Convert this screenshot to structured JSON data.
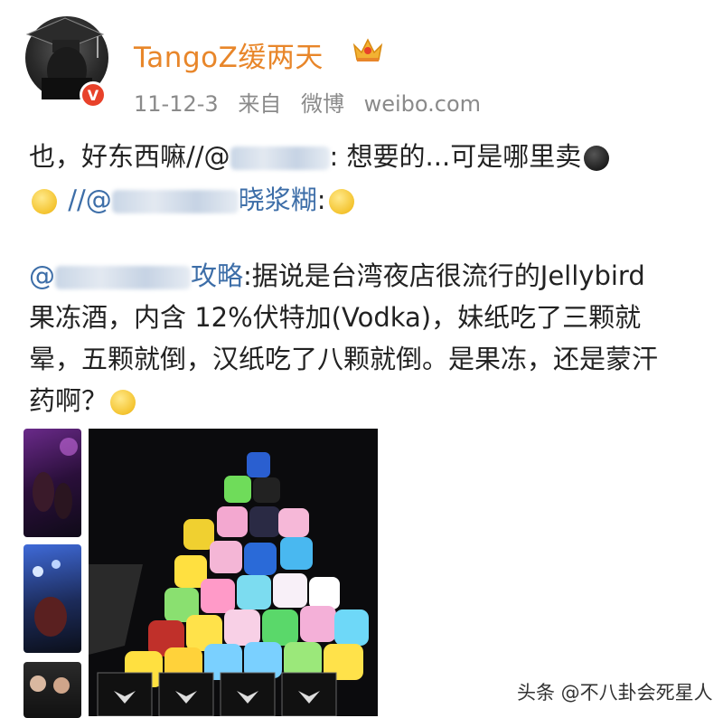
{
  "post": {
    "username": "TangoZ缓两天",
    "date": "11-12-3",
    "source_prefix": "来自",
    "source_app": "微博",
    "source_domain": "weibo.com",
    "verified_badge": "V",
    "line1_text": "也，好东西嘛//@",
    "line1_after": ": 想要的...可是哪里卖",
    "line2_prefix": "//@",
    "line2_name_end": "晓浆糊",
    "line2_after": ":"
  },
  "retweet": {
    "at": "@",
    "name_end": "攻略",
    "line1_rest": ":据说是台湾夜店很流行的Jellybird",
    "line2": "果冻酒，内含 12%伏特加(Vodka)，妹纸吃了三颗就",
    "line3": "晕，五颗就倒，汉纸吃了八颗就倒。是果冻，还是蒙汗",
    "line4": "药啊？"
  },
  "icons": {
    "avatar": "graduation-cap-avatar",
    "crown": "crown-icon",
    "emoji_cry": "crying-face-icon",
    "emoji_shy": "shy-face-icon",
    "emoji_think": "thinking-face-icon",
    "emoji_surprised": "surprised-face-icon"
  },
  "colors": {
    "username": "#e8862a",
    "mention": "#3d6ea8",
    "meta": "#8a8a8a",
    "badge": "#e8412a"
  },
  "watermark": "头条 @不八卦会死星人"
}
